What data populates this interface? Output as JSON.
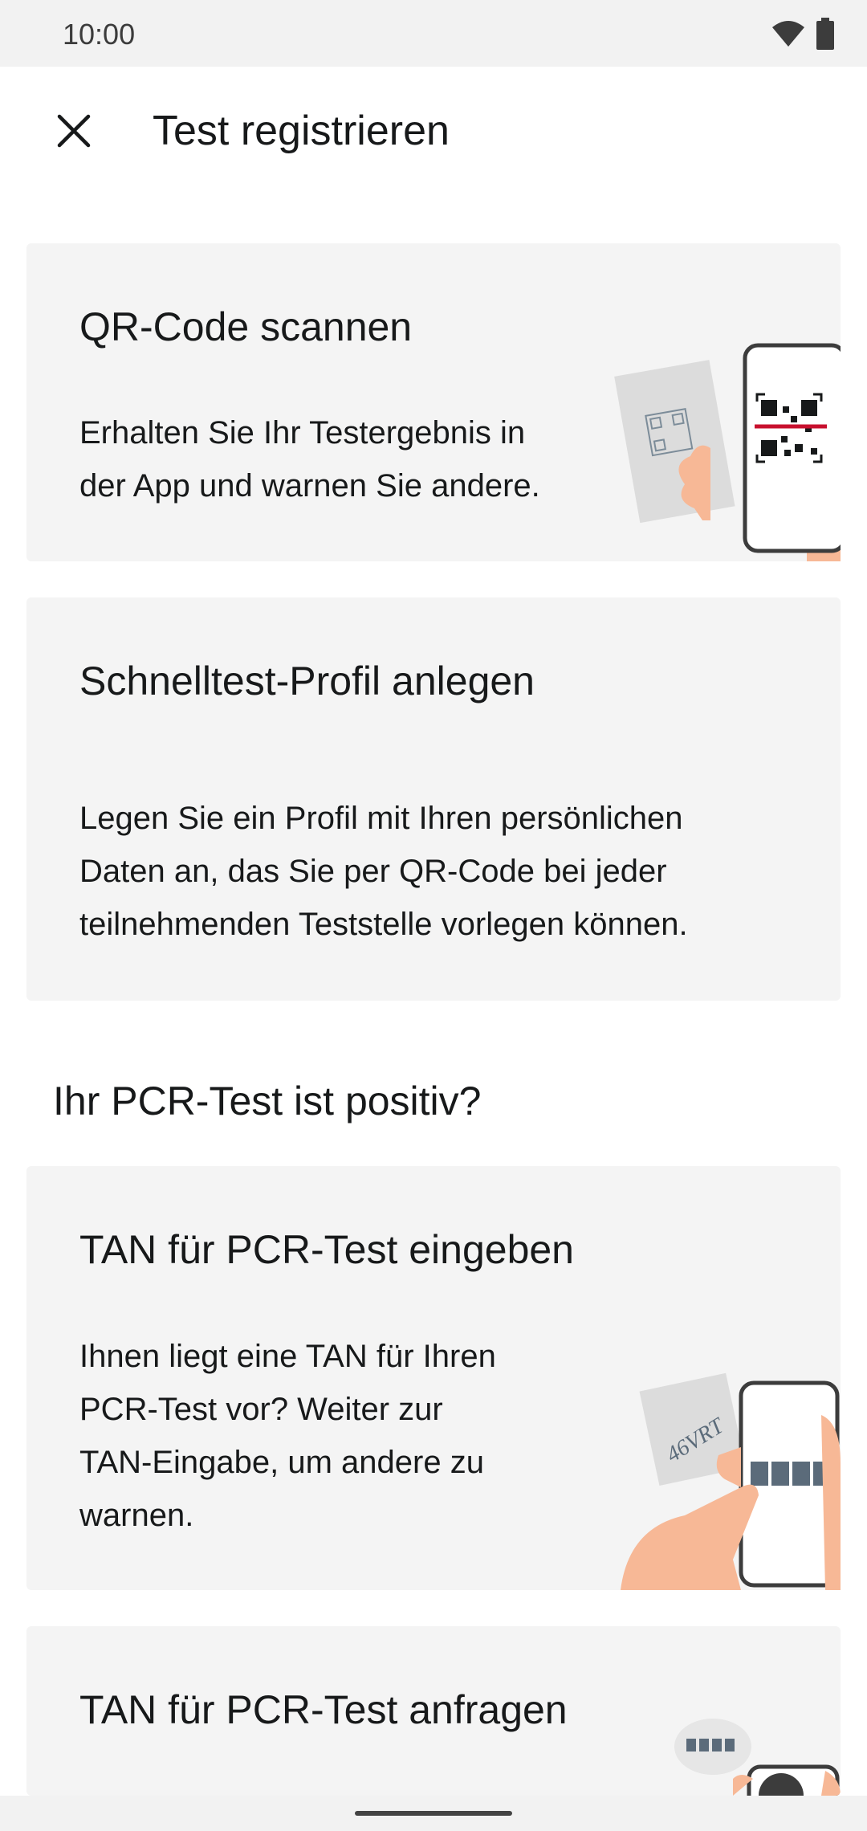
{
  "status_bar": {
    "time": "10:00",
    "icons": [
      "wifi-icon",
      "battery-icon"
    ]
  },
  "header": {
    "close_icon": "close-icon",
    "title": "Test registrieren"
  },
  "cards": [
    {
      "title": "QR-Code scannen",
      "text_lines": [
        "Erhalten Sie Ihr Testergebnis in",
        "der App und warnen Sie andere."
      ],
      "illustration": "qr-scan-phone-illustration"
    },
    {
      "title": "Schnelltest-Profil anlegen",
      "text_lines": [
        "Legen Sie ein Profil mit Ihren persönlichen",
        "Daten an, das Sie per QR-Code bei jeder",
        "teilnehmenden Teststelle vorlegen können."
      ]
    },
    {
      "title": "TAN für PCR-Test eingeben",
      "text_lines": [
        "Ihnen liegt eine TAN für Ihren",
        "PCR-Test vor? Weiter zur",
        "TAN-Eingabe, um andere zu",
        "warnen."
      ],
      "illustration": "tan-entry-phone-illustration",
      "illustration_text": "46VRT"
    },
    {
      "title": "TAN für PCR-Test anfragen",
      "illustration": "tan-request-phone-illustration"
    }
  ],
  "section_heading": "Ihr PCR-Test ist positiv?",
  "colors": {
    "card_bg": "#f4f4f4",
    "skin": "#f7b896",
    "scan_line": "#c8102e",
    "tan_box": "#5b6b7a"
  }
}
